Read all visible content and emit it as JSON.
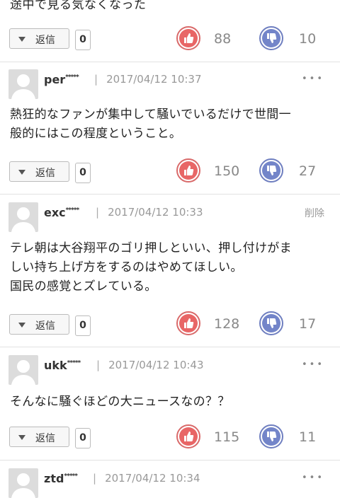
{
  "partial_top_text": "途中で見る気なくなった",
  "reply_label": "返信",
  "comments": [
    {
      "reply_count": "0",
      "likes": "88",
      "dislikes": "10"
    },
    {
      "user": "per",
      "stars": "*****",
      "timestamp": "2017/04/12 10:37",
      "menu": "•••",
      "body_lines": [
        "熱狂的なファンが集中して騒いでいるだけで世間一",
        "般的にはこの程度ということ。"
      ],
      "reply_count": "0",
      "likes": "150",
      "dislikes": "27"
    },
    {
      "user": "exc",
      "stars": "*****",
      "timestamp": "2017/04/12 10:33",
      "action": "削除",
      "body_lines": [
        "テレ朝は大谷翔平のゴリ押しといい、押し付けがま",
        "しい持ち上げ方をするのはやめてほしい。",
        "国民の感覚とズレている。"
      ],
      "reply_count": "0",
      "likes": "128",
      "dislikes": "17"
    },
    {
      "user": "ukk",
      "stars": "*****",
      "timestamp": "2017/04/12 10:43",
      "menu": "•••",
      "body_lines": [
        "そんなに騒ぐほどの大ニュースなの？？"
      ],
      "reply_count": "0",
      "likes": "115",
      "dislikes": "11"
    },
    {
      "user": "ztd",
      "stars": "*****",
      "timestamp": "2017/04/12 10:34",
      "menu": "•••"
    }
  ],
  "icons": {
    "like": "thumbs-up-icon",
    "dislike": "thumbs-down-icon",
    "reply_toggle": "triangle-down-icon",
    "avatar": "default-user-avatar-icon"
  },
  "colors": {
    "like": "#e86666",
    "dislike": "#7385c9",
    "meta": "#999999"
  }
}
